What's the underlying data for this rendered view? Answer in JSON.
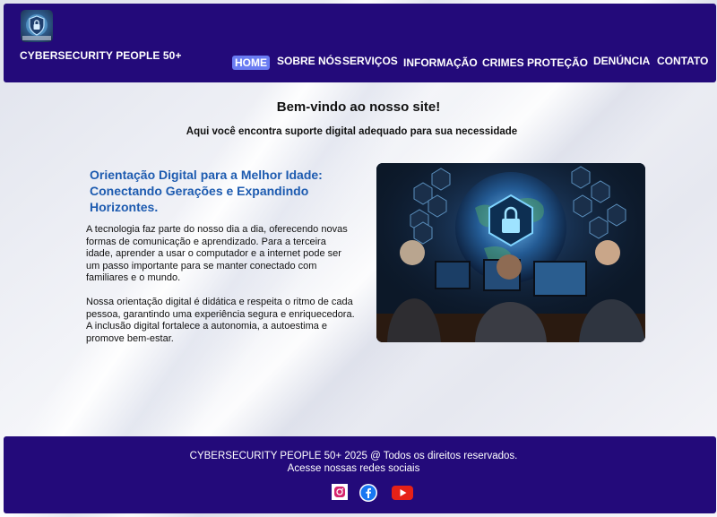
{
  "header": {
    "brand": "CYBERSECURITY PEOPLE 50+",
    "logo_icon": "shield-lock-icon",
    "nav": [
      {
        "label": "HOME",
        "active": true
      },
      {
        "label": "SOBRE NÓS"
      },
      {
        "label": "SERVIÇOS"
      },
      {
        "label": "INFORMAÇÃO"
      },
      {
        "label": "CRIMES"
      },
      {
        "label": "PROTEÇÃO"
      },
      {
        "label": "DENÚNCIA"
      },
      {
        "label": "CONTATO"
      }
    ]
  },
  "main": {
    "welcome": "Bem-vindo ao nosso site!",
    "tagline": "Aqui você encontra suporte digital adequado para sua necessidade",
    "section_title": "Orientação Digital para a Melhor Idade: Conectando Gerações e Expandindo Horizontes.",
    "paragraphs": [
      "A tecnologia faz parte do nosso dia a dia, oferecendo novas formas de comunicação e aprendizado. Para a terceira idade, aprender a usar o computador e a internet pode ser um passo importante para se manter conectado com familiares e o mundo.",
      "Nossa orientação digital é didática e respeita o ritmo de cada pessoa, garantindo uma experiência segura e enriquecedora. A inclusão digital fortalece a autonomia, a autoestima e promove bem-estar."
    ]
  },
  "footer": {
    "copyright": "CYBERSECURITY PEOPLE 50+ 2025 @ Todos os direitos reservados.",
    "social_text": "Acesse nossas redes sociais",
    "social_icons": [
      "instagram-icon",
      "facebook-icon",
      "youtube-icon"
    ]
  },
  "colors": {
    "header_bg": "#230a7a",
    "active_nav": "#6a7cf2",
    "title_blue": "#1d5bb0"
  }
}
